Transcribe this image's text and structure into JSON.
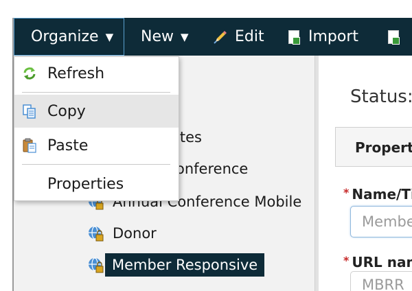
{
  "toolbar": {
    "organize": "Organize",
    "new": "New",
    "edit": "Edit",
    "import": "Import",
    "caret": "▼"
  },
  "menu": {
    "items": [
      {
        "label": "Refresh",
        "icon": "refresh-icon"
      },
      {
        "label": "Copy",
        "icon": "copy-icon",
        "hovered": true
      },
      {
        "label": "Paste",
        "icon": "paste-icon"
      },
      {
        "label": "Properties",
        "icon": ""
      }
    ]
  },
  "tree": {
    "items": [
      {
        "label": "ites",
        "partial": true
      },
      {
        "label": "onference",
        "partial": true
      },
      {
        "label": "Annual Conference Mobile"
      },
      {
        "label": "Donor"
      },
      {
        "label": "Member Responsive",
        "selected": true
      }
    ]
  },
  "detail": {
    "status_label": "Status:",
    "tab_label": "Properti",
    "name_label": "Name/Ti",
    "name_value": "Membe",
    "url_label": "URL nam",
    "url_value": "MBRR"
  },
  "colors": {
    "toolbar_bg": "#0e2b38",
    "selected_bg": "#0e2b38",
    "required": "#c62828",
    "accent_border": "#5aa0d0"
  }
}
